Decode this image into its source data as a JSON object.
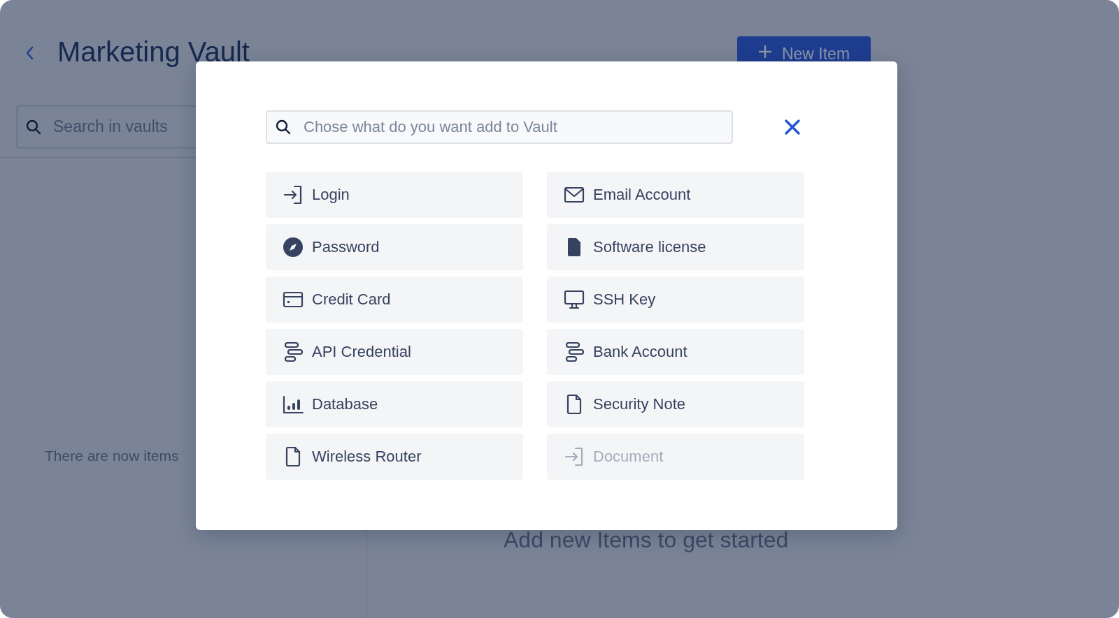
{
  "header": {
    "title": "Marketing Vault",
    "new_item_button": "New Item"
  },
  "sidebar": {
    "search": {
      "placeholder": "Search in vaults"
    },
    "empty_text": "There are now items"
  },
  "main": {
    "empty_text": "Add new Items to get started"
  },
  "dialog": {
    "search": {
      "placeholder": "Chose what do you want add to Vault"
    },
    "items": [
      {
        "label": "Login",
        "kind": "login",
        "disabled": false
      },
      {
        "label": "Email Account",
        "kind": "email",
        "disabled": false
      },
      {
        "label": "Password",
        "kind": "password",
        "disabled": false
      },
      {
        "label": "Software license",
        "kind": "license",
        "disabled": false
      },
      {
        "label": "Credit Card",
        "kind": "card",
        "disabled": false
      },
      {
        "label": "SSH Key",
        "kind": "ssh",
        "disabled": false
      },
      {
        "label": "API Credential",
        "kind": "api",
        "disabled": false
      },
      {
        "label": "Bank Account",
        "kind": "bank",
        "disabled": false
      },
      {
        "label": "Database",
        "kind": "database",
        "disabled": false
      },
      {
        "label": "Security Note",
        "kind": "note",
        "disabled": false
      },
      {
        "label": "Wireless Router",
        "kind": "router",
        "disabled": false
      },
      {
        "label": "Document",
        "kind": "document",
        "disabled": true
      }
    ]
  }
}
